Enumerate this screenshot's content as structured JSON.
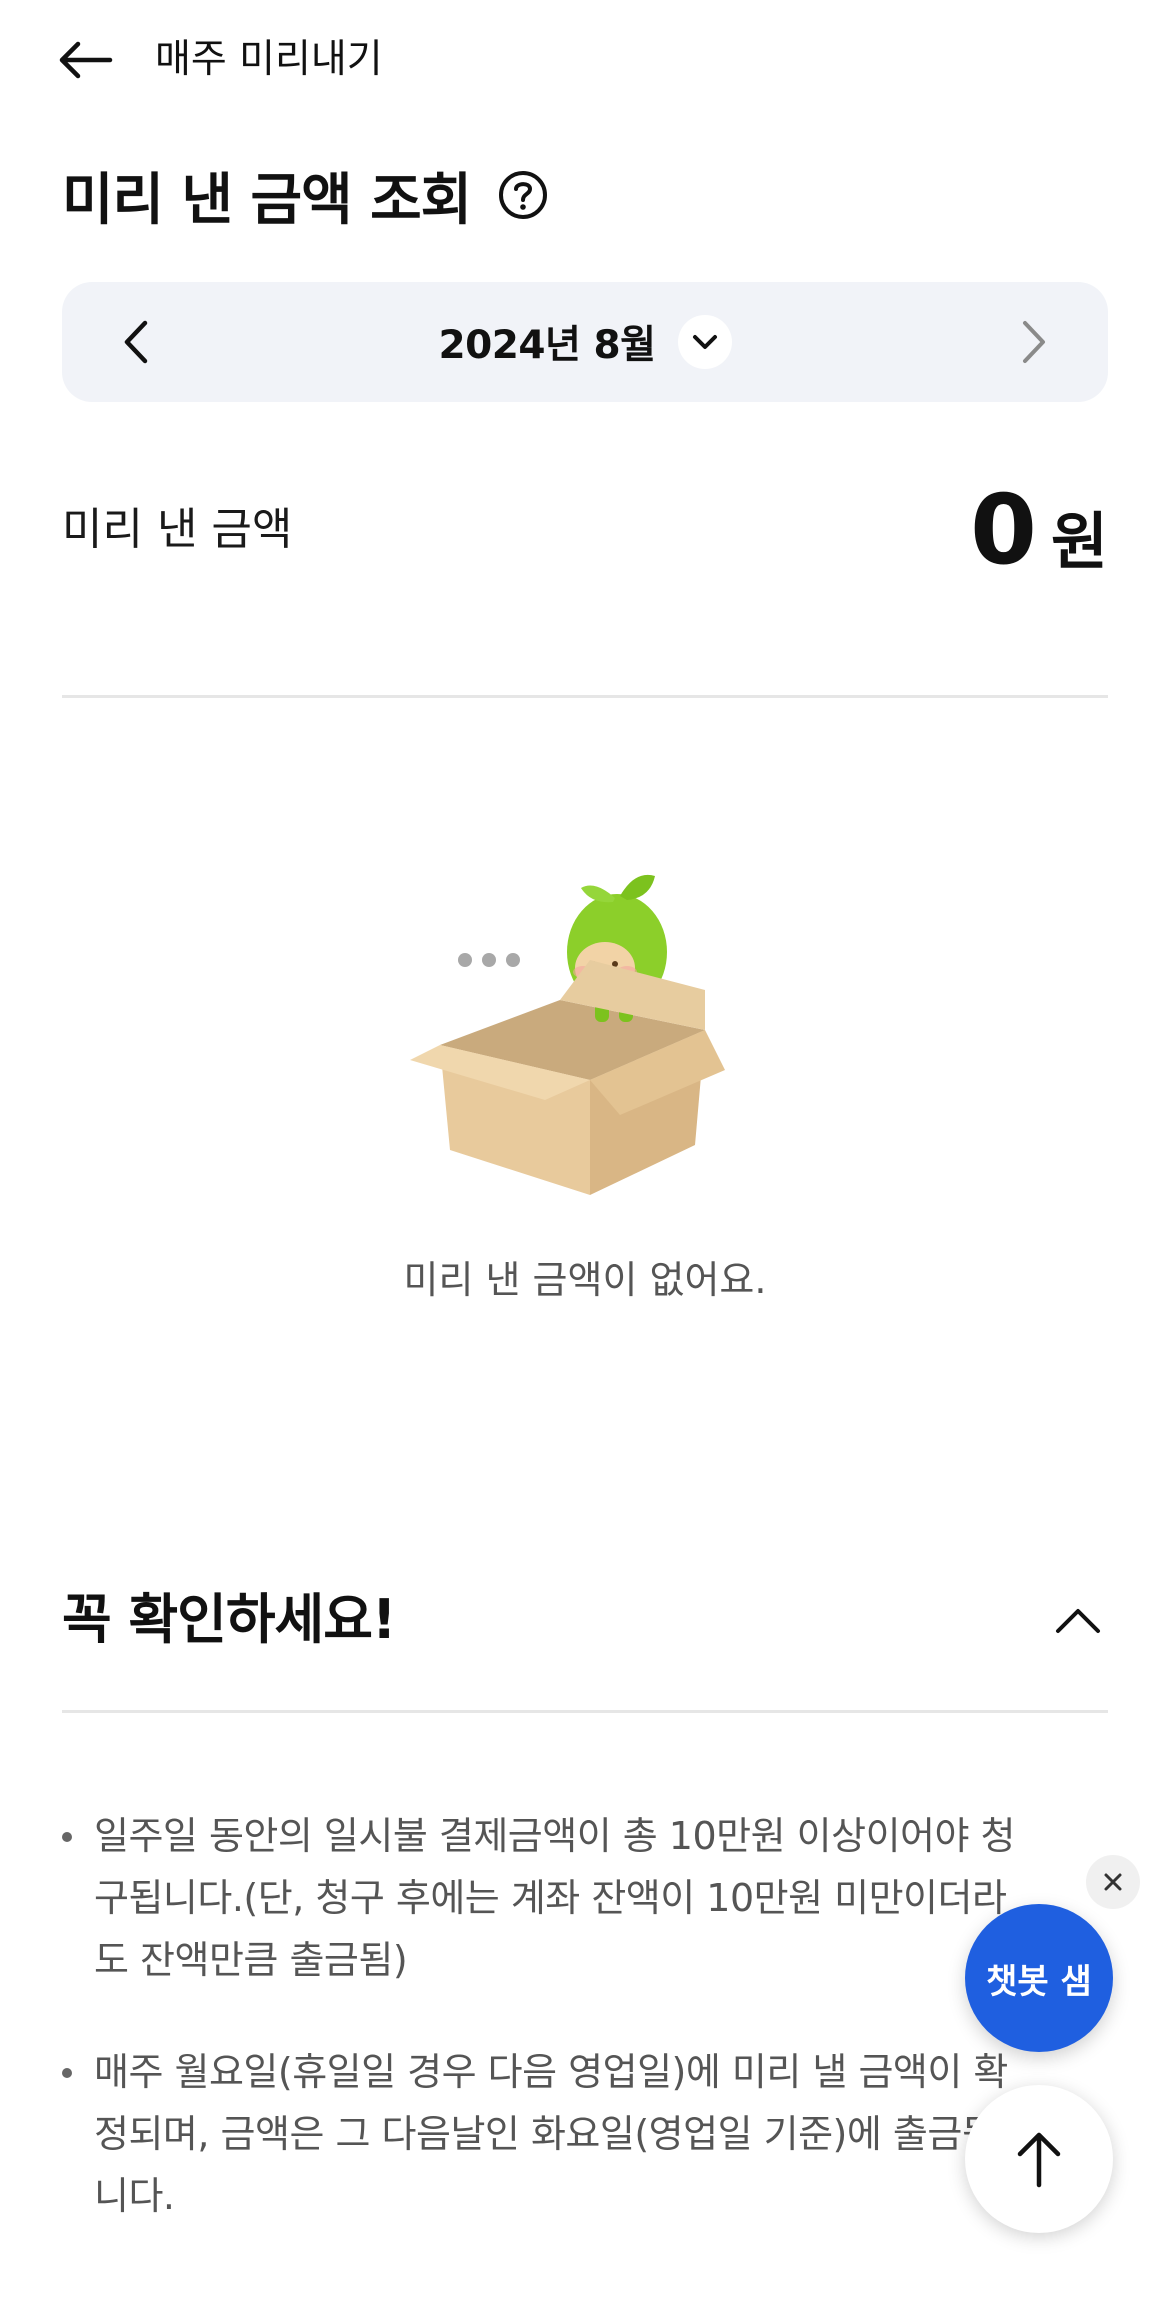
{
  "topbar": {
    "title": "매주 미리내기"
  },
  "page": {
    "title": "미리 낸 금액 조회"
  },
  "month_nav": {
    "label": "2024년 8월"
  },
  "summary": {
    "label": "미리 낸 금액",
    "amount": "0",
    "unit": "원"
  },
  "empty_state": {
    "message": "미리 낸 금액이 없어요."
  },
  "notice": {
    "title": "꼭 확인하세요!",
    "items": [
      {
        "text": "일주일 동안의 일시불 결제금액이 총 10만원 이상이어야 청구됩니다.(단, 청구 후에는 계좌 잔액이 10만원 미만이더라도 잔액만큼 출금됨)"
      },
      {
        "text": "매주 월요일(휴일일 경우 다음 영업일)에 미리 낼 금액이 확정되며, 금액은 그 다음날인 화요일(영업일 기준)에 출금됩니다."
      }
    ]
  },
  "floating": {
    "chatbot_label": "챗봇 샘"
  },
  "colors": {
    "accent": "#1f5fe0",
    "nav_bg": "#f1f3f8",
    "mascot_green": "#8ccf2a"
  },
  "icons": [
    "arrow-left-icon",
    "question-circle-icon",
    "chevron-left-icon",
    "chevron-right-icon",
    "chevron-down-icon",
    "chevron-up-icon",
    "close-icon",
    "arrow-up-icon"
  ]
}
